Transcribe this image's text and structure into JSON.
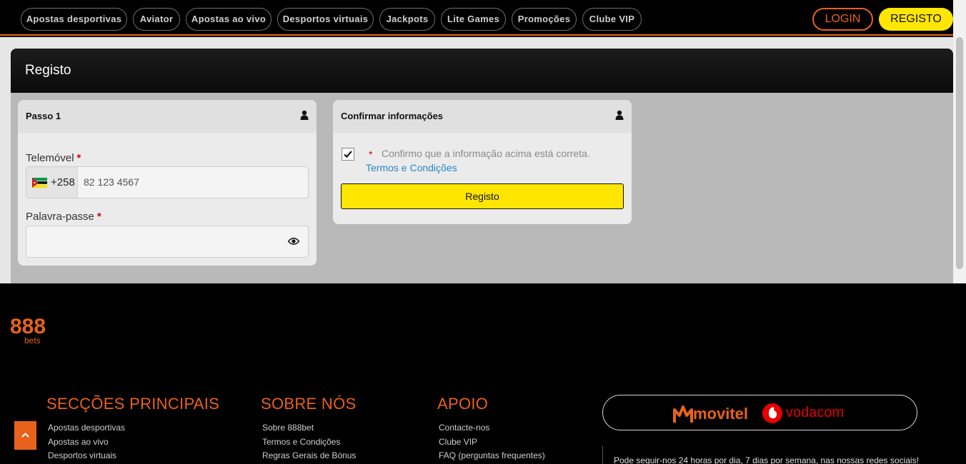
{
  "nav": {
    "items": [
      "Apostas desportivas",
      "Aviator",
      "Apostas ao vivo",
      "Desportos virtuais",
      "Jackpots",
      "Lite Games",
      "Promoções",
      "Clube VIP"
    ],
    "login": "LOGIN",
    "register": "REGISTO"
  },
  "page": {
    "title": "Registo"
  },
  "step1": {
    "title": "Passo 1",
    "phone_label": "Telemóvel",
    "phone_prefix": "+258",
    "phone_placeholder": "82 123 4567",
    "password_label": "Palavra-passe",
    "required_mark": "*"
  },
  "confirm": {
    "title": "Confirmar informações",
    "checkbox_checked": true,
    "required_mark": "*",
    "text": "Confirmo que a informação acima está correta.",
    "terms_link": "Termos e Condições",
    "submit": "Registo"
  },
  "footer": {
    "logo": {
      "top": "888",
      "bottom": "bets"
    },
    "sections": [
      {
        "title": "SECÇÕES PRINCIPAIS",
        "links": [
          "Apostas desportivas",
          "Apostas ao vivo",
          "Desportos virtuais"
        ]
      },
      {
        "title": "SOBRE NÓS",
        "links": [
          "Sobre 888bet",
          "Termos e Condições",
          "Regras Gerais de Bónus"
        ]
      },
      {
        "title": "APOIO",
        "links": [
          "Contacte-nos",
          "Clube VIP",
          "FAQ (perguntas frequentes)"
        ]
      }
    ],
    "partners": {
      "movitel": "movitel",
      "vodacom": "vodacom"
    },
    "follow_text": "Pode seguir-nos 24 horas por dia, 7 dias por semana, nas nossas redes sociais!"
  },
  "colors": {
    "accent": "#e8621c",
    "yellow": "#ffe600",
    "link": "#2a85c9",
    "required": "#d0021b"
  }
}
